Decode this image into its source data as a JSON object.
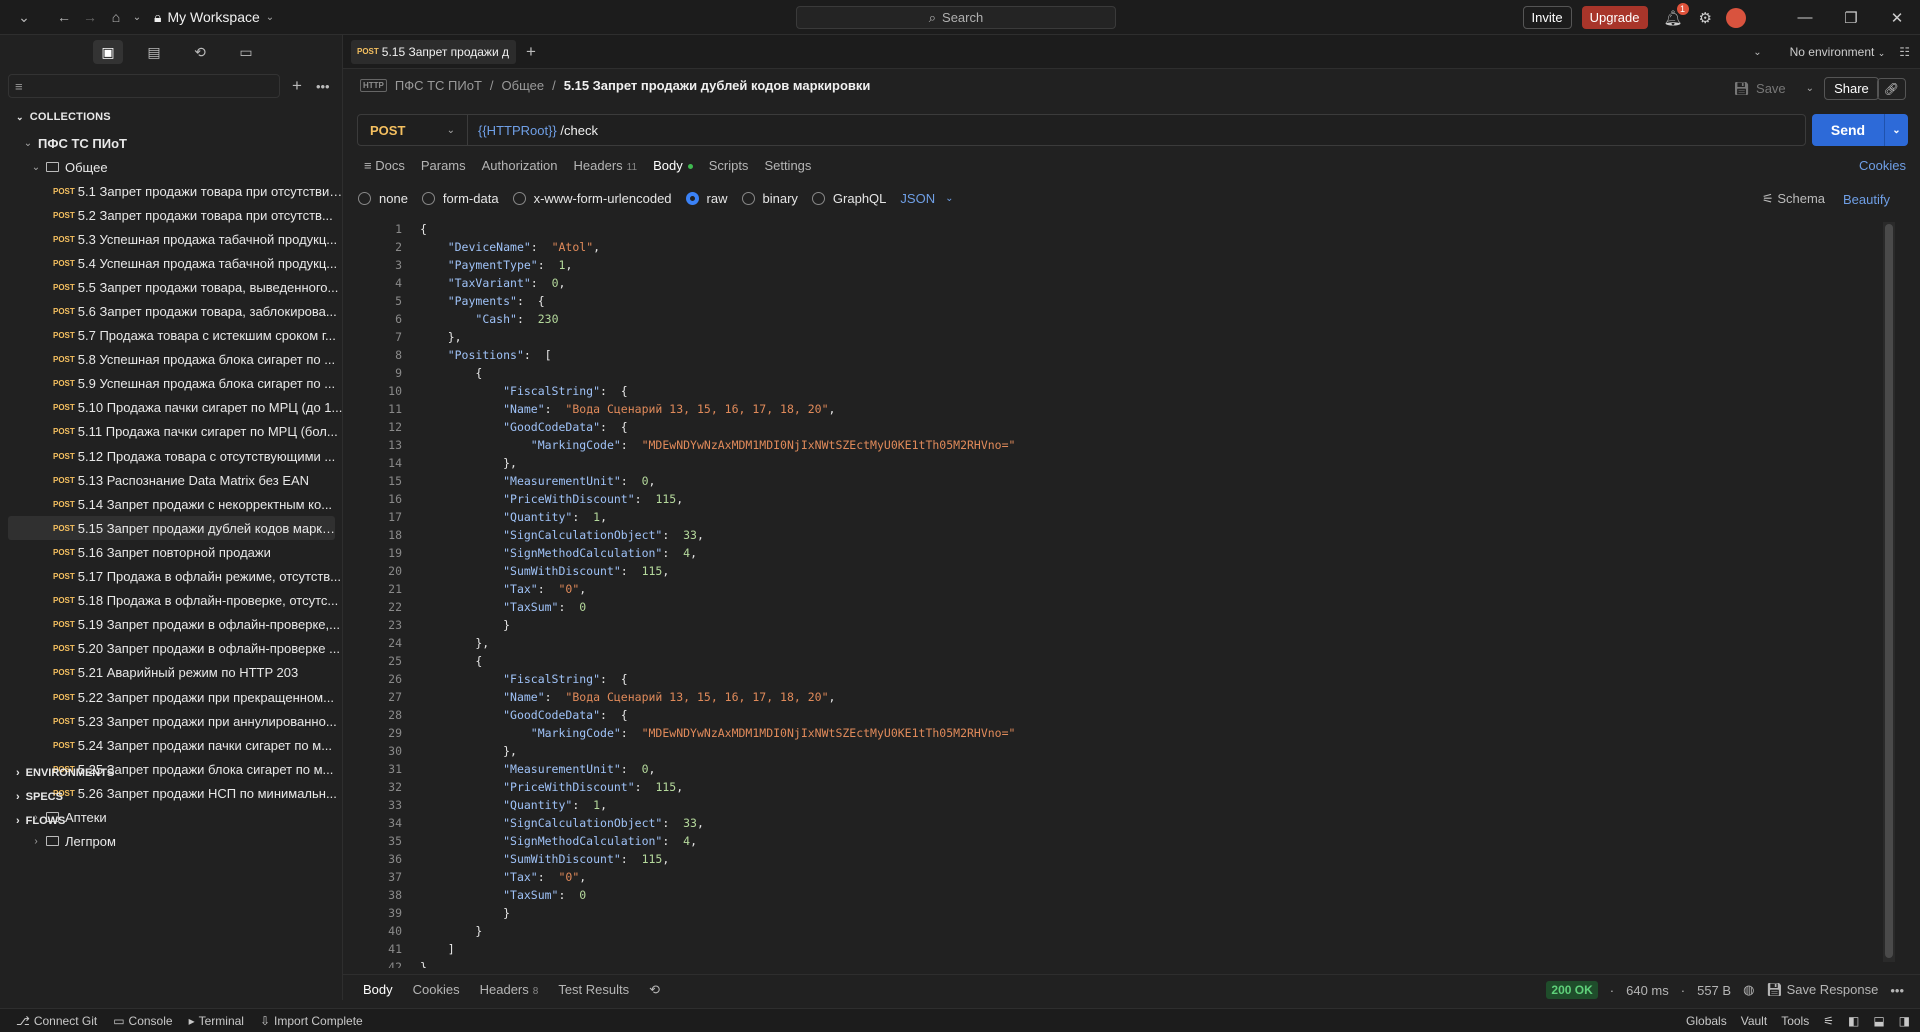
{
  "topbar": {
    "workspace": "My Workspace",
    "search_placeholder": "Search",
    "invite": "Invite",
    "upgrade": "Upgrade",
    "notification_count": "1"
  },
  "sidebar": {
    "collections_label": "COLLECTIONS",
    "collection_name": "ПФС ТС ПИоТ",
    "folder_open": "Общее",
    "requests": [
      "5.1 Запрет продажи товара при отсутствии...",
      "5.2 Запрет продажи товара при отсутств...",
      "5.3 Успешная продажа табачной продукц...",
      "5.4 Успешная продажа табачной продукц...",
      "5.5 Запрет продажи товара, выведенного...",
      "5.6 Запрет продажи товара, заблокирова...",
      "5.7 Продажа товара с истекшим сроком г...",
      "5.8 Успешная продажа блока сигарет по ...",
      "5.9 Успешная продажа блока сигарет по ...",
      "5.10 Продажа пачки сигарет по МРЦ (до 1...",
      "5.11 Продажа пачки сигарет по МРЦ (бол...",
      "5.12 Продажа товара с отсутствующими ...",
      "5.13 Распознание Data Matrix без EAN",
      "5.14 Запрет продажи с некорректным ко...",
      "5.15 Запрет продажи дублей кодов марки...",
      "5.16 Запрет повторной продажи",
      "5.17 Продажа в офлайн режиме, отсутств...",
      "5.18 Продажа в офлайн-проверке, отсутс...",
      "5.19 Запрет продажи в офлайн-проверке,...",
      "5.20 Запрет продажи в офлайн-проверке ...",
      "5.21 Аварийный режим по HTTP 203",
      "5.22 Запрет продажи при прекращенном...",
      "5.23 Запрет продажи при аннулированно...",
      "5.24 Запрет продажи пачки сигарет по м...",
      "5.25 Запрет продажи блока сигарет по м...",
      "5.26 Запрет продажи НСП по минимальн..."
    ],
    "method_tag": "POST",
    "folders_closed": [
      "Аптеки",
      "Легпром"
    ],
    "environments": "ENVIRONMENTS",
    "specs": "SPECS",
    "flows": "FLOWS"
  },
  "tab": {
    "method": "POST",
    "label": "5.15 Запрет продажи д"
  },
  "environment": "No environment",
  "breadcrumb": {
    "collection": "ПФС ТС ПИоТ",
    "folder": "Общее",
    "current": "5.15 Запрет продажи дублей кодов маркировки",
    "save": "Save",
    "share": "Share"
  },
  "request": {
    "method": "POST",
    "url_var": "{{HTTPRoot}}",
    "url_path": " /check",
    "send": "Send"
  },
  "request_tabs": {
    "docs": "Docs",
    "params": "Params",
    "authorization": "Authorization",
    "headers": "Headers",
    "headers_count": "11",
    "body": "Body",
    "scripts": "Scripts",
    "settings": "Settings",
    "cookies": "Cookies"
  },
  "body_types": {
    "none": "none",
    "form_data": "form-data",
    "urlencoded": "x-www-form-urlencoded",
    "raw": "raw",
    "binary": "binary",
    "graphql": "GraphQL",
    "format": "JSON",
    "schema": "Schema",
    "beautify": "Beautify"
  },
  "code_lines": [
    "{",
    "    \"DeviceName\":  \"Atol\",",
    "    \"PaymentType\":  1,",
    "    \"TaxVariant\":  0,",
    "    \"Payments\":  {",
    "        \"Cash\":  230",
    "    },",
    "    \"Positions\":  [",
    "        {",
    "            \"FiscalString\":  {",
    "            \"Name\":  \"Вода Сценарий 13, 15, 16, 17, 18, 20\",",
    "            \"GoodCodeData\":  {",
    "                \"MarkingCode\":  \"MDEwNDYwNzAxMDM1MDI0NjIxNWtSZEctMyU0KE1tTh05M2RHVno=\"",
    "            },",
    "            \"MeasurementUnit\":  0,",
    "            \"PriceWithDiscount\":  115,",
    "            \"Quantity\":  1,",
    "            \"SignCalculationObject\":  33,",
    "            \"SignMethodCalculation\":  4,",
    "            \"SumWithDiscount\":  115,",
    "            \"Tax\":  \"0\",",
    "            \"TaxSum\":  0",
    "            }",
    "        },",
    "        {",
    "            \"FiscalString\":  {",
    "            \"Name\":  \"Вода Сценарий 13, 15, 16, 17, 18, 20\",",
    "            \"GoodCodeData\":  {",
    "                \"MarkingCode\":  \"MDEwNDYwNzAxMDM1MDI0NjIxNWtSZEctMyU0KE1tTh05M2RHVno=\"",
    "            },",
    "            \"MeasurementUnit\":  0,",
    "            \"PriceWithDiscount\":  115,",
    "            \"Quantity\":  1,",
    "            \"SignCalculationObject\":  33,",
    "            \"SignMethodCalculation\":  4,",
    "            \"SumWithDiscount\":  115,",
    "            \"Tax\":  \"0\",",
    "            \"TaxSum\":  0",
    "            }",
    "        }",
    "    ]",
    "}"
  ],
  "response": {
    "body": "Body",
    "cookies": "Cookies",
    "headers": "Headers",
    "headers_count": "8",
    "test_results": "Test Results",
    "status": "200 OK",
    "time": "640 ms",
    "size": "557 B",
    "save_response": "Save Response"
  },
  "statusbar": {
    "connect_git": "Connect Git",
    "console": "Console",
    "terminal": "Terminal",
    "import_complete": "Import Complete",
    "globals": "Globals",
    "vault": "Vault",
    "tools": "Tools"
  },
  "colors": {
    "accent": "#2d6ad8",
    "post_method": "#f5c060",
    "upgrade": "#a8352a",
    "status_ok": "#5fd07a"
  }
}
